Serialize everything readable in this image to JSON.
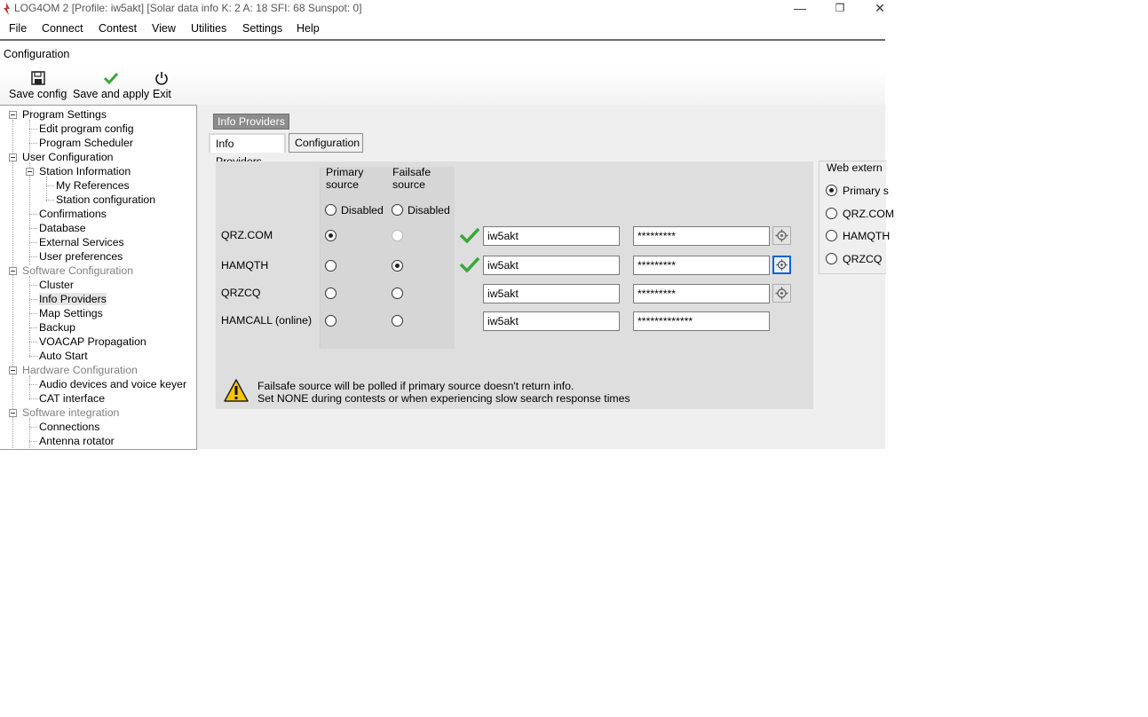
{
  "window": {
    "title": "LOG4OM 2 [Profile: iw5akt] [Solar data info K: 2 A: 18 SFI: 68 Sunspot: 0]",
    "controls": {
      "minimize": "—",
      "restore": "❐",
      "close": "✕"
    }
  },
  "menu": [
    "File",
    "Connect",
    "Contest",
    "View",
    "Utilities",
    "Settings",
    "Help"
  ],
  "config_title": "Configuration",
  "toolbar": {
    "save_config": "Save config",
    "save_apply": "Save and apply",
    "exit": "Exit"
  },
  "tree": {
    "program_settings": "Program Settings",
    "edit_program_config": "Edit program config",
    "program_scheduler": "Program Scheduler",
    "user_configuration": "User Configuration",
    "station_information": "Station Information",
    "my_references": "My References",
    "station_configuration": "Station configuration",
    "confirmations": "Confirmations",
    "database": "Database",
    "external_services": "External Services",
    "user_preferences": "User preferences",
    "software_configuration": "Software Configuration",
    "cluster": "Cluster",
    "info_providers": "Info Providers",
    "map_settings": "Map Settings",
    "backup": "Backup",
    "voacap_propagation": "VOACAP Propagation",
    "auto_start": "Auto Start",
    "hardware_configuration": "Hardware Configuration",
    "audio_devices": "Audio devices and voice keyer",
    "cat_interface": "CAT interface",
    "software_integration": "Software integration",
    "connections": "Connections",
    "antenna_rotator": "Antenna rotator"
  },
  "section_tag": "Info Providers",
  "tabs": {
    "info_providers": "Info Providers",
    "configuration": "Configuration"
  },
  "columns": {
    "primary": "Primary\nsource",
    "failsafe": "Failsafe\nsource",
    "disabled": "Disabled"
  },
  "providers": [
    {
      "name": "QRZ.COM",
      "primary": true,
      "failsafe": false,
      "verified": true,
      "username": "iw5akt",
      "password": "*********"
    },
    {
      "name": "HAMQTH",
      "primary": false,
      "failsafe": true,
      "verified": true,
      "username": "iw5akt",
      "password": "*********"
    },
    {
      "name": "QRZCQ",
      "primary": false,
      "failsafe": false,
      "verified": false,
      "username": "iw5akt",
      "password": "*********"
    },
    {
      "name": "HAMCALL (online)",
      "primary": false,
      "failsafe": false,
      "verified": false,
      "username": "iw5akt",
      "password": "*************"
    }
  ],
  "warning": {
    "line1": "Failsafe source will be polled if primary source doesn't return info.",
    "line2": "Set NONE during contests or when experiencing slow search response times"
  },
  "web_group": {
    "title": "Web extern",
    "options": [
      "Primary s",
      "QRZ.COM",
      "HAMQTH",
      "QRZCQ"
    ]
  }
}
